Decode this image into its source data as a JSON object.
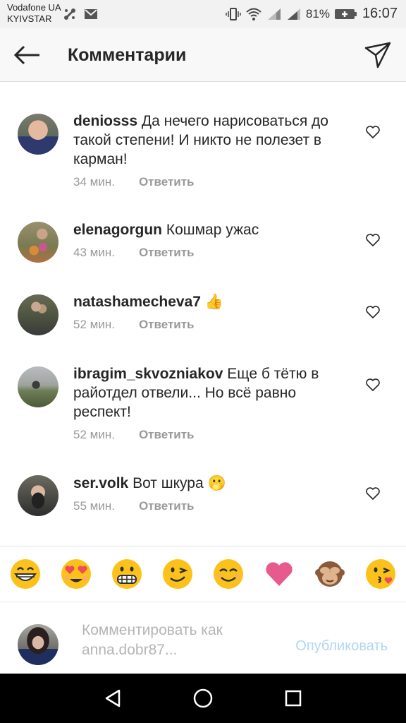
{
  "status_bar": {
    "carrier_1": "Vodafone UA",
    "carrier_2": "KYIVSTAR",
    "battery": "81%",
    "time": "16:07"
  },
  "header": {
    "title": "Комментарии",
    "back_icon": "arrow-left-icon",
    "send_icon": "paper-plane-icon"
  },
  "comments": [
    {
      "username": "deniosss",
      "text": "Да нечего нарисоваться до такой степени! И никто не полезет в карман!",
      "time": "34 мин.",
      "reply": "Ответить"
    },
    {
      "username": "elenagorgun",
      "text": "Кошмар ужас",
      "time": "43 мин.",
      "reply": "Ответить"
    },
    {
      "username": "natashamecheva7",
      "text": "👍",
      "time": "52 мин.",
      "reply": "Ответить"
    },
    {
      "username": "ibragim_skvozniakov",
      "text": "Еще б тётю в райотдел отвели... Но всё равно респект!",
      "time": "52 мин.",
      "reply": "Ответить"
    },
    {
      "username": "ser.volk",
      "text": "Вот шкура 🫢",
      "time": "55 мин.",
      "reply": "Ответить"
    }
  ],
  "emoji_bar": [
    "grin-emoji",
    "heart-eyes-emoji",
    "grimace-emoji",
    "wink-emoji",
    "smile-emoji",
    "heart-emoji",
    "see-no-evil-monkey-emoji",
    "kiss-emoji"
  ],
  "composer": {
    "placeholder_line1": "Комментировать как",
    "placeholder_line2": "anna.dobr87...",
    "publish_label": "Опубликовать"
  },
  "colors": {
    "link_disabled": "#b3d5f5",
    "muted": "#999999",
    "text": "#262626"
  }
}
